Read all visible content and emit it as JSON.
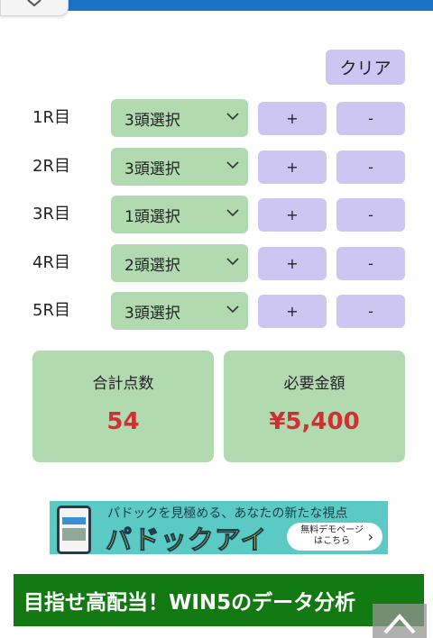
{
  "header": {
    "close_icon": "close-icon",
    "accent_color": "#1a73c4"
  },
  "controls": {
    "clear_label": "クリア"
  },
  "races": [
    {
      "label": "1R目",
      "selection": "3頭選択",
      "plus": "+",
      "minus": "-"
    },
    {
      "label": "2R目",
      "selection": "3頭選択",
      "plus": "+",
      "minus": "-"
    },
    {
      "label": "3R目",
      "selection": "1頭選択",
      "plus": "+",
      "minus": "-"
    },
    {
      "label": "4R目",
      "selection": "2頭選択",
      "plus": "+",
      "minus": "-"
    },
    {
      "label": "5R目",
      "selection": "3頭選択",
      "plus": "+",
      "minus": "-"
    }
  ],
  "summary": {
    "total_label": "合計点数",
    "total_value": "54",
    "amount_label": "必要金額",
    "amount_value": "¥5,400",
    "value_color": "#d03030"
  },
  "ad": {
    "headline": "パドックを見極める、あなたの新たな視点",
    "logo": "パドックアイ",
    "cta": "無料デモページはこちら",
    "cta_icon": "chevron-right-icon"
  },
  "section": {
    "title": "目指せ高配当！WIN5のデータ分析"
  },
  "scroll_top": {
    "icon": "chevron-up-icon"
  }
}
